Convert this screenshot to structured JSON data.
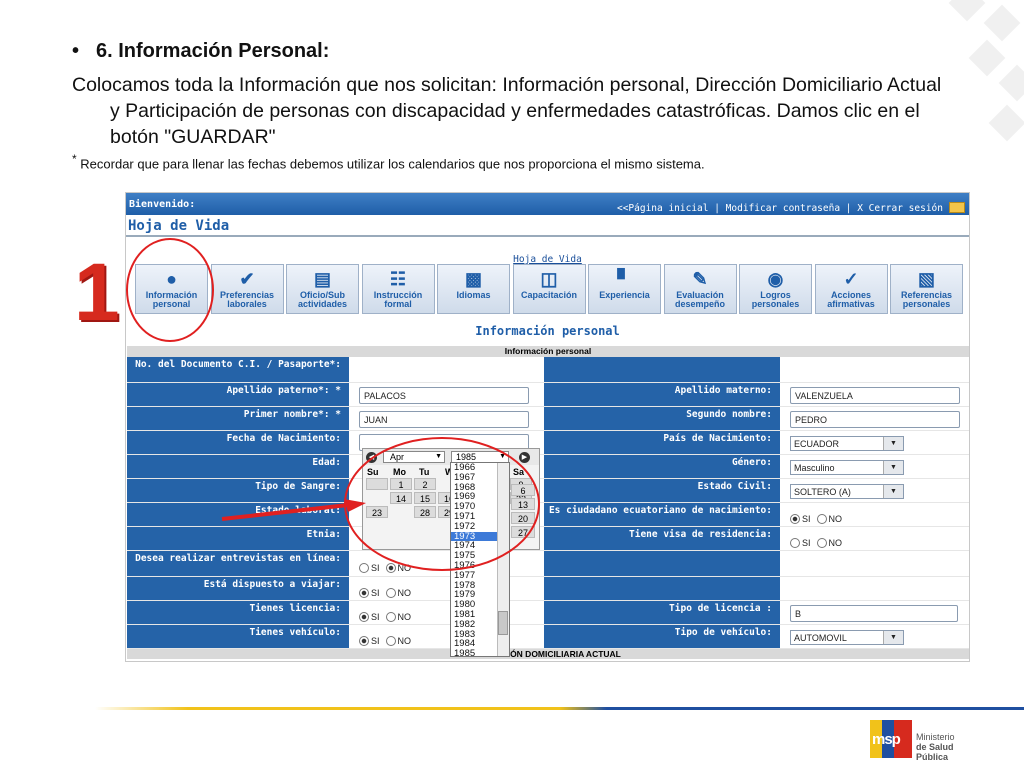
{
  "slide": {
    "bullet": "•",
    "heading": "6. Información Personal:",
    "paragraph": "Colocamos toda la Información que nos solicitan: Información personal, Dirección Domiciliario Actual y Participación de personas con discapacidad y enfermedades catastróficas. Damos clic en el botón \"GUARDAR\"",
    "note_star": "*",
    "note": " Recordar que para llenar las fechas debemos utilizar los calendarios que nos proporciona el mismo sistema.",
    "step_number": "1"
  },
  "app": {
    "welcome": "Bienvenido:",
    "links": "<<Página inicial | Modificar contraseña | X Cerrar sesión",
    "page_title": "Hoja de Vida",
    "hv_link": "Hoja de Vida",
    "tabs": [
      {
        "label": "Información personal",
        "icon": "person-icon"
      },
      {
        "label": "Preferencias laborales",
        "icon": "check-icon"
      },
      {
        "label": "Oficio/Sub actividades",
        "icon": "id-card-icon"
      },
      {
        "label": "Instrucción formal",
        "icon": "book-icon"
      },
      {
        "label": "Idiomas",
        "icon": "chat-icon"
      },
      {
        "label": "Capacitación",
        "icon": "presentation-icon"
      },
      {
        "label": "Experiencia",
        "icon": "stairs-icon"
      },
      {
        "label": "Evaluación desempeño",
        "icon": "edit-icon"
      },
      {
        "label": "Logros personales",
        "icon": "medal-icon"
      },
      {
        "label": "Acciones afirmativas",
        "icon": "hand-check-icon"
      },
      {
        "label": "Referencias personales",
        "icon": "comments-icon"
      }
    ],
    "section_title": "Información personal",
    "form_header": "Información personal",
    "footer_header": "DIRECCIÓN DOMICILIARIA ACTUAL"
  },
  "form": {
    "doc_label": "No. del Documento C.I. / Pasaporte*:",
    "ap_pat_label": "Apellido paterno*:  *",
    "ap_pat": "PALACOS",
    "ap_mat_label": "Apellido materno:",
    "ap_mat": "VALENZUELA",
    "nombre_label": "Primer nombre*:  *",
    "nombre": "JUAN",
    "seg_nombre_label": "Segundo nombre:",
    "seg_nombre": "PEDRO",
    "fecha_label": "Fecha de Nacimiento:",
    "pais_label": "País de Nacimiento:",
    "pais": "ECUADOR",
    "edad_label": "Edad:",
    "genero_label": "Género:",
    "genero": "Masculino",
    "sangre_label": "Tipo de Sangre:",
    "civil_label": "Estado Civil:",
    "civil": "SOLTERO (A)",
    "laboral_label": "Estado laboral:",
    "ciudadano_label": "Es ciudadano ecuatoriano de nacimiento:",
    "etnia_label": "Etnia:",
    "visa_label": "Tiene visa de residencia:",
    "entrevista_label": "Desea realizar entrevistas en línea:",
    "viajar_label": "Está dispuesto a viajar:",
    "licencia_label": "Tienes licencia:",
    "tipo_lic_label": "Tipo de licencia :",
    "tipo_lic": "B",
    "vehiculo_label": "Tienes vehículo:",
    "tipo_veh_label": "Tipo de vehículo:",
    "tipo_veh": "AUTOMOVIL",
    "si": "SI",
    "no": "NO"
  },
  "calendar": {
    "month": "Apr",
    "year": "1985",
    "day_names": [
      "Su",
      "Mo",
      "Tu",
      "W",
      "Sa"
    ],
    "days": [
      "",
      "1",
      "2",
      "",
      "7",
      "8",
      "9",
      "",
      "14",
      "15",
      "16",
      "",
      "21",
      "22",
      "23",
      "",
      "28",
      "29",
      "30",
      ""
    ],
    "sat_days": [
      "6",
      "13",
      "20",
      "27"
    ],
    "years": [
      "1966",
      "1967",
      "1968",
      "1969",
      "1970",
      "1971",
      "1972",
      "1973",
      "1974",
      "1975",
      "1976",
      "1977",
      "1978",
      "1979",
      "1980",
      "1981",
      "1982",
      "1983",
      "1984",
      "1985"
    ],
    "selected_year": "1973"
  },
  "logo": {
    "mark": "msp",
    "line1": "Ministerio",
    "line2": "de Salud Pública"
  },
  "colors": {
    "accent_blue": "#2563a8",
    "annotation_red": "#e02020",
    "brand_yellow": "#f1c21a"
  }
}
